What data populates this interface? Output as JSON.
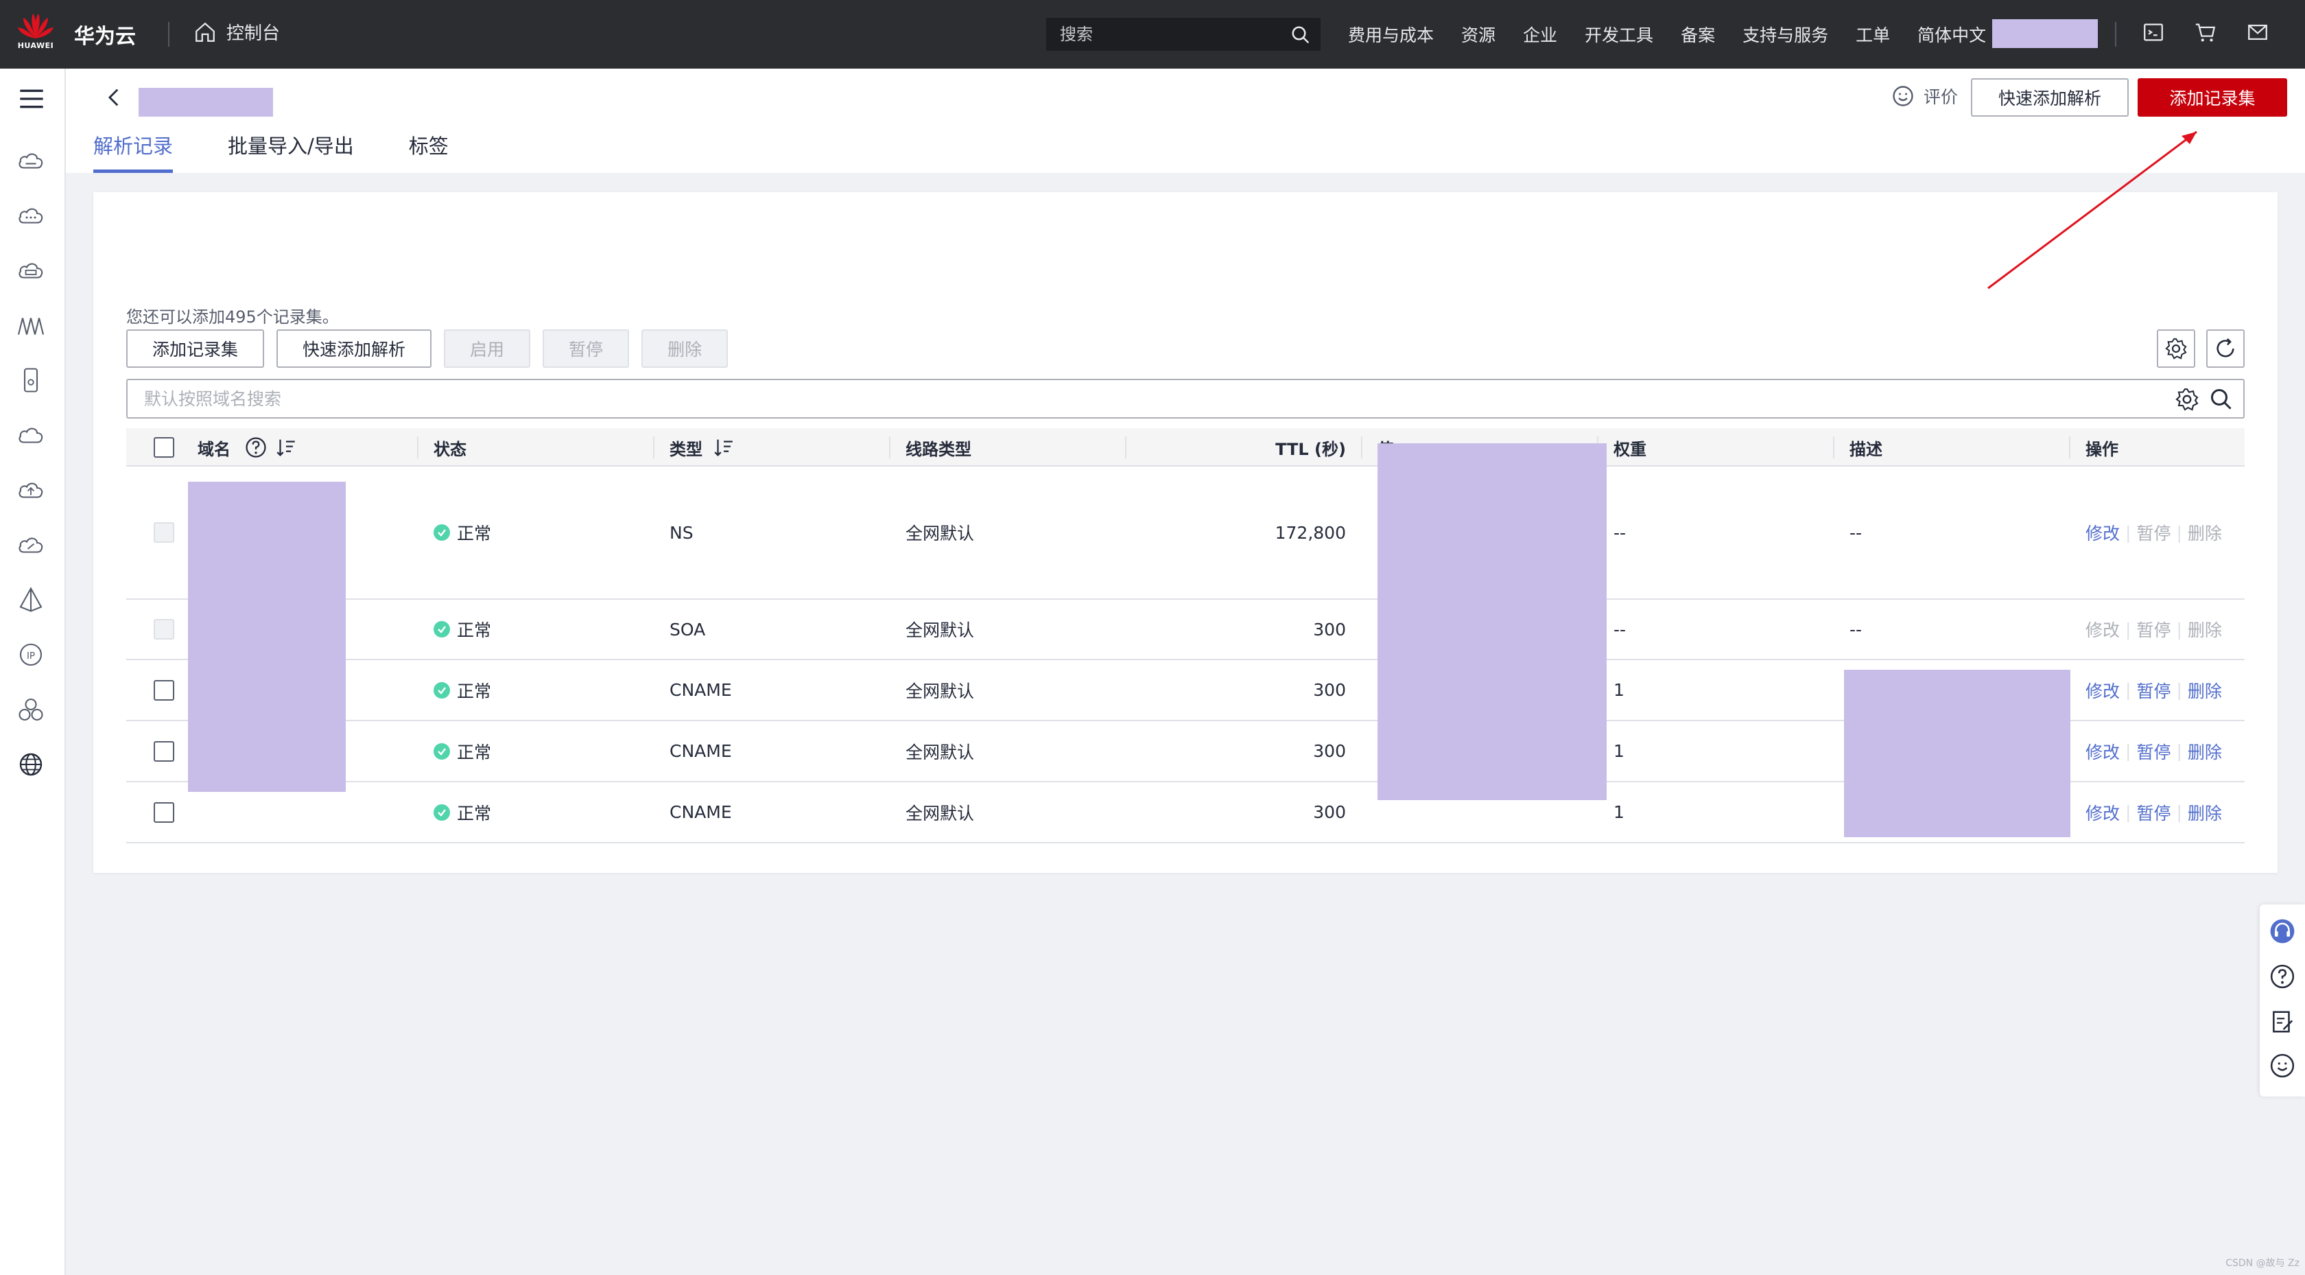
{
  "topbar": {
    "logo_text": "HUAWEI",
    "brand": "华为云",
    "console_label": "控制台",
    "search_placeholder": "搜索",
    "nav": [
      "费用与成本",
      "资源",
      "企业",
      "开发工具",
      "备案",
      "支持与服务",
      "工单",
      "简体中文"
    ]
  },
  "header": {
    "rate_label": "评价",
    "quick_add_label": "快速添加解析",
    "add_record_label": "添加记录集",
    "tabs": [
      {
        "label": "解析记录",
        "active": true
      },
      {
        "label": "批量导入/导出",
        "active": false
      },
      {
        "label": "标签",
        "active": false
      }
    ]
  },
  "toolbar": {
    "remaining_text": "您还可以添加495个记录集。",
    "add_record_label": "添加记录集",
    "quick_add_label": "快速添加解析",
    "enable_label": "启用",
    "pause_label": "暂停",
    "delete_label": "删除",
    "filter_placeholder": "默认按照域名搜索"
  },
  "table": {
    "headers": {
      "domain": "域名",
      "status": "状态",
      "type": "类型",
      "line": "线路类型",
      "ttl": "TTL (秒)",
      "value": "值",
      "weight": "权重",
      "desc": "描述",
      "ops": "操作"
    },
    "rows": [
      {
        "status": "正常",
        "type": "NS",
        "line": "全网默认",
        "ttl": "172,800",
        "weight": "--",
        "desc": "--",
        "edit": "修改",
        "pause": "暂停",
        "delete": "删除",
        "ops_enabled": [
          true,
          false,
          false
        ]
      },
      {
        "status": "正常",
        "type": "SOA",
        "line": "全网默认",
        "ttl": "300",
        "weight": "--",
        "desc": "--",
        "edit": "修改",
        "pause": "暂停",
        "delete": "删除",
        "ops_enabled": [
          false,
          false,
          false
        ]
      },
      {
        "status": "正常",
        "type": "CNAME",
        "line": "全网默认",
        "ttl": "300",
        "weight": "1",
        "desc": "",
        "edit": "修改",
        "pause": "暂停",
        "delete": "删除",
        "ops_enabled": [
          true,
          true,
          true
        ]
      },
      {
        "status": "正常",
        "type": "CNAME",
        "line": "全网默认",
        "ttl": "300",
        "weight": "1",
        "desc": "",
        "edit": "修改",
        "pause": "暂停",
        "delete": "删除",
        "ops_enabled": [
          true,
          true,
          true
        ]
      },
      {
        "status": "正常",
        "type": "CNAME",
        "line": "全网默认",
        "ttl": "300",
        "weight": "1",
        "desc": "",
        "edit": "修改",
        "pause": "暂停",
        "delete": "删除",
        "ops_enabled": [
          true,
          true,
          true
        ]
      }
    ]
  },
  "watermark": "CSDN @故与 Zz",
  "colors": {
    "brand_red": "#c7000b",
    "link_blue": "#526ecc",
    "status_green": "#50d4ab",
    "redaction": "#c8bde8"
  }
}
